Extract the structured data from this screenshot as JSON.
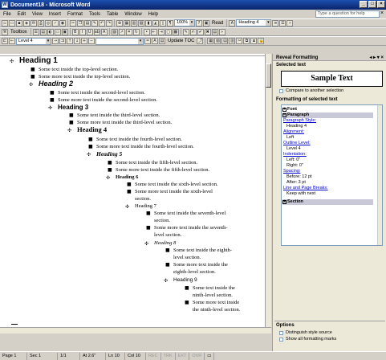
{
  "window": {
    "title": "Document18 - Microsoft Word",
    "controls": [
      "_",
      "□",
      "×"
    ]
  },
  "menu": {
    "items": [
      "File",
      "Edit",
      "View",
      "Insert",
      "Format",
      "Tools",
      "Table",
      "Window",
      "Help"
    ],
    "ask_placeholder": "Type a question for help",
    "close": "×"
  },
  "toolbar1": {
    "zoom": "100%",
    "read_label": "Read",
    "style": "Heading 4"
  },
  "toolbar2": {
    "toolbox_label": "Toolbox"
  },
  "outline_bar": {
    "level": "Level 4",
    "update_toc": "Update TOC"
  },
  "document": {
    "lines": [
      {
        "cls": "h1",
        "sym": "✣",
        "text": "Heading 1"
      },
      {
        "cls": "bt",
        "sym": "■",
        "text": "Some text inside the top-level section."
      },
      {
        "cls": "bt",
        "sym": "■",
        "text": "Some more text inside the top-level section."
      },
      {
        "cls": "h2",
        "sym": "✣",
        "text": "Heading 2"
      },
      {
        "cls": "bt",
        "sym": "■",
        "text": "Some text inside the second-level section."
      },
      {
        "cls": "bt",
        "sym": "■",
        "text": "Some more text inside the second-level section."
      },
      {
        "cls": "h3",
        "sym": "✣",
        "text": "Heading 3"
      },
      {
        "cls": "bt",
        "sym": "■",
        "text": "Some text inside the third-level section."
      },
      {
        "cls": "bt",
        "sym": "■",
        "text": "Some more text inside the third-level section."
      },
      {
        "cls": "h4",
        "sym": "✣",
        "text": "Heading 4"
      },
      {
        "cls": "bt",
        "sym": "■",
        "text": "Some text inside the fourth-level section."
      },
      {
        "cls": "bt",
        "sym": "■",
        "text": "Some more text inside the fourth-level section."
      },
      {
        "cls": "h5",
        "sym": "✣",
        "text": "Heading 5"
      },
      {
        "cls": "bt",
        "sym": "■",
        "text": "Some text inside the fifth-level section."
      },
      {
        "cls": "bt",
        "sym": "■",
        "text": "Some more text inside the fifth-level section."
      },
      {
        "cls": "h6",
        "sym": "✣",
        "text": "Heading 6"
      },
      {
        "cls": "bt",
        "sym": "■",
        "text": "Some text inside the sixth-level section."
      },
      {
        "cls": "bt",
        "sym": "■",
        "text": "Some more text inside the sixth-level section."
      },
      {
        "cls": "h7",
        "sym": "✣",
        "text": "Heading 7"
      },
      {
        "cls": "bt",
        "sym": "■",
        "text": "Some text inside the seventh-level section."
      },
      {
        "cls": "bt",
        "sym": "■",
        "text": "Some more text inside the seventh-level section."
      },
      {
        "cls": "h8",
        "sym": "✣",
        "text": "Heading 8"
      },
      {
        "cls": "bt",
        "sym": "■",
        "text": "Some text inside the eighth-level section."
      },
      {
        "cls": "bt",
        "sym": "■",
        "text": "Some more text inside the eighth-level section."
      },
      {
        "cls": "h9",
        "sym": "✣",
        "text": "Heading 9"
      },
      {
        "cls": "bt",
        "sym": "■",
        "text": "Some text inside the ninth-level section."
      },
      {
        "cls": "bt",
        "sym": "■",
        "text": "Some more text inside the ninth-level section."
      }
    ]
  },
  "reveal": {
    "title": "Reveal Formatting",
    "selected_text_label": "Selected text",
    "sample": "Sample Text",
    "compare_label": "Compare to another selection",
    "formatting_label": "Formatting of selected text",
    "items": [
      {
        "kind": "hd",
        "text": "Font",
        "pm": "+"
      },
      {
        "kind": "hd",
        "text": "Paragraph",
        "pm": "−",
        "selected": true
      },
      {
        "kind": "lk",
        "text": "Paragraph Style:"
      },
      {
        "kind": "vl",
        "text": "Heading 4"
      },
      {
        "kind": "lk",
        "text": "Alignment:"
      },
      {
        "kind": "vl",
        "text": "Left"
      },
      {
        "kind": "lk",
        "text": "Outline Level:"
      },
      {
        "kind": "vl",
        "text": "Level 4"
      },
      {
        "kind": "lk",
        "text": "Indentation:"
      },
      {
        "kind": "vl",
        "text": "Left:  0\""
      },
      {
        "kind": "vl",
        "text": "Right:  0\""
      },
      {
        "kind": "lk",
        "text": "Spacing:"
      },
      {
        "kind": "vl",
        "text": "Before:  12 pt"
      },
      {
        "kind": "vl",
        "text": "After:  3 pt"
      },
      {
        "kind": "lk",
        "text": "Line and Page Breaks:"
      },
      {
        "kind": "vl",
        "text": "Keep with next"
      },
      {
        "kind": "hd",
        "text": "Section",
        "pm": "+",
        "selected": true
      }
    ],
    "options_label": "Options",
    "distinguish_label": "Distinguish style source",
    "show_marks_label": "Show all formatting marks"
  },
  "status": {
    "page": "Page 1",
    "sec": "Sec 1",
    "pages": "1/1",
    "at": "At 2.6\"",
    "ln": "Ln 10",
    "col": "Col 10",
    "rec": "REC",
    "trk": "TRK",
    "ext": "EXT",
    "ovr": "OVR"
  }
}
